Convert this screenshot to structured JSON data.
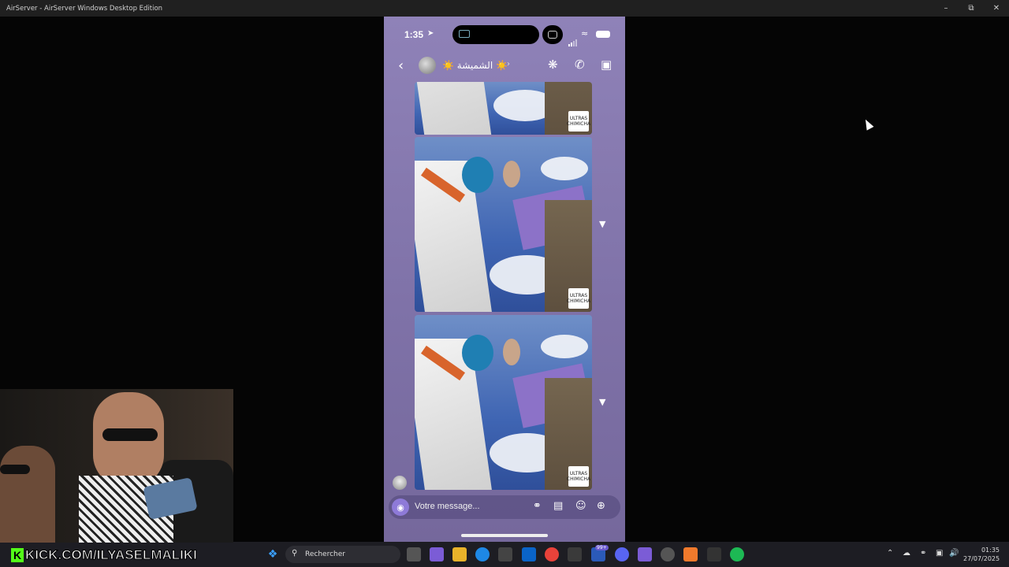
{
  "window": {
    "title": "AirServer - AirServer Windows Desktop Edition"
  },
  "phone": {
    "status": {
      "time": "1:35"
    },
    "chat": {
      "title": "الشميشة"
    },
    "composer": {
      "placeholder": "Votre message..."
    },
    "media_logo": "ULTRAS CHIMICHA"
  },
  "taskbar": {
    "search_label": "Rechercher",
    "badge": "99+",
    "time": "01:35",
    "date": "27/07/2025"
  },
  "overlay": {
    "kick_text": "KICK.COM/ILYASELMALIKI",
    "kick_logo": "K"
  },
  "colors": {
    "chat_bg": "#8f82b8",
    "taskbar": "#1d1d23",
    "kick_green": "#53fc18"
  }
}
